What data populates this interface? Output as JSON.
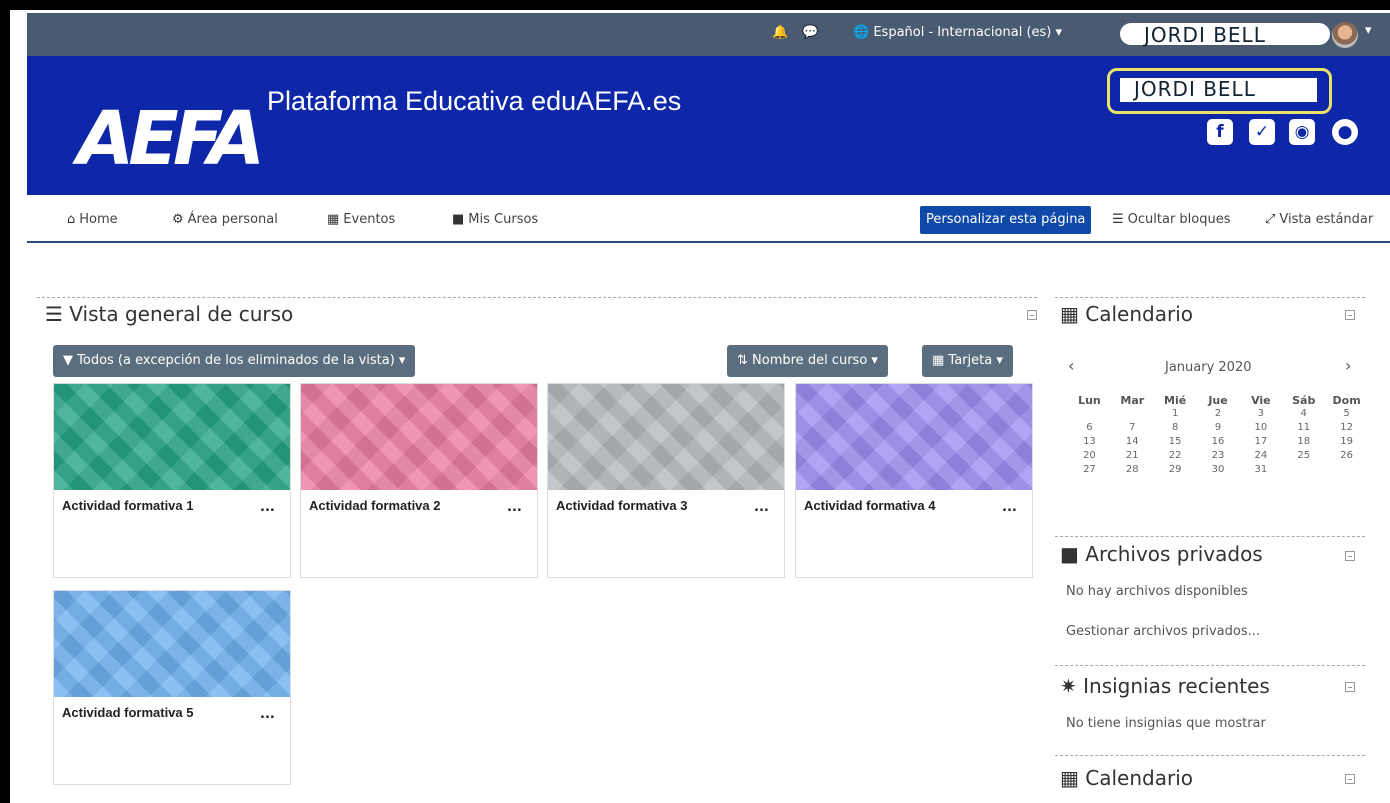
{
  "topbar": {
    "language": "Español - Internacional (es)",
    "username": "JORDI BELL"
  },
  "header": {
    "logo": "AEFA",
    "title": "Plataforma Educativa eduAEFA.es",
    "highlight_name": "JORDI BELL",
    "social": [
      "facebook-icon",
      "twitter-icon",
      "instagram-icon",
      "globe-icon"
    ]
  },
  "nav": {
    "items": [
      {
        "icon": "home-icon",
        "label": "Home"
      },
      {
        "icon": "dashboard-icon",
        "label": "Área personal"
      },
      {
        "icon": "calendar-icon",
        "label": "Eventos"
      },
      {
        "icon": "briefcase-icon",
        "label": "Mis Cursos"
      }
    ],
    "customize": "Personalizar esta página",
    "hide_blocks": "Ocultar bloques",
    "standard_view": "Vista estándar"
  },
  "overview": {
    "title": "Vista general de curso",
    "filter": "Todos (a excepción de los eliminados de la vista)",
    "sort": "Nombre del curso",
    "view": "Tarjeta",
    "courses": [
      {
        "name": "Actividad formativa 1",
        "color": "#27a584"
      },
      {
        "name": "Actividad formativa 2",
        "color": "#ec7ea4"
      },
      {
        "name": "Actividad formativa 3",
        "color": "#b4babf"
      },
      {
        "name": "Actividad formativa 4",
        "color": "#9e8ff2"
      },
      {
        "name": "Actividad formativa 5",
        "color": "#6fb2ef"
      }
    ],
    "more": "..."
  },
  "calendar": {
    "title": "Calendario",
    "month": "January 2020",
    "weekdays": [
      "Lun",
      "Mar",
      "Mié",
      "Jue",
      "Vie",
      "Sáb",
      "Dom"
    ],
    "weeks": [
      [
        "",
        "",
        "1",
        "2",
        "3",
        "4",
        "5"
      ],
      [
        "6",
        "7",
        "8",
        "9",
        "10",
        "11",
        "12"
      ],
      [
        "13",
        "14",
        "15",
        "16",
        "17",
        "18",
        "19"
      ],
      [
        "20",
        "21",
        "22",
        "23",
        "24",
        "25",
        "26"
      ],
      [
        "27",
        "28",
        "29",
        "30",
        "31",
        "",
        ""
      ]
    ]
  },
  "private_files": {
    "title": "Archivos privados",
    "empty": "No hay archivos disponibles",
    "manage": "Gestionar archivos privados..."
  },
  "badges": {
    "title": "Insignias recientes",
    "empty": "No tiene insignias que mostrar"
  },
  "calendar2": {
    "title": "Calendario"
  },
  "colors": {
    "header_blue": "#0e27a8",
    "topbar": "#4a5a70",
    "button_dark": "#5a6e80",
    "highlight": "#e9e36b"
  }
}
